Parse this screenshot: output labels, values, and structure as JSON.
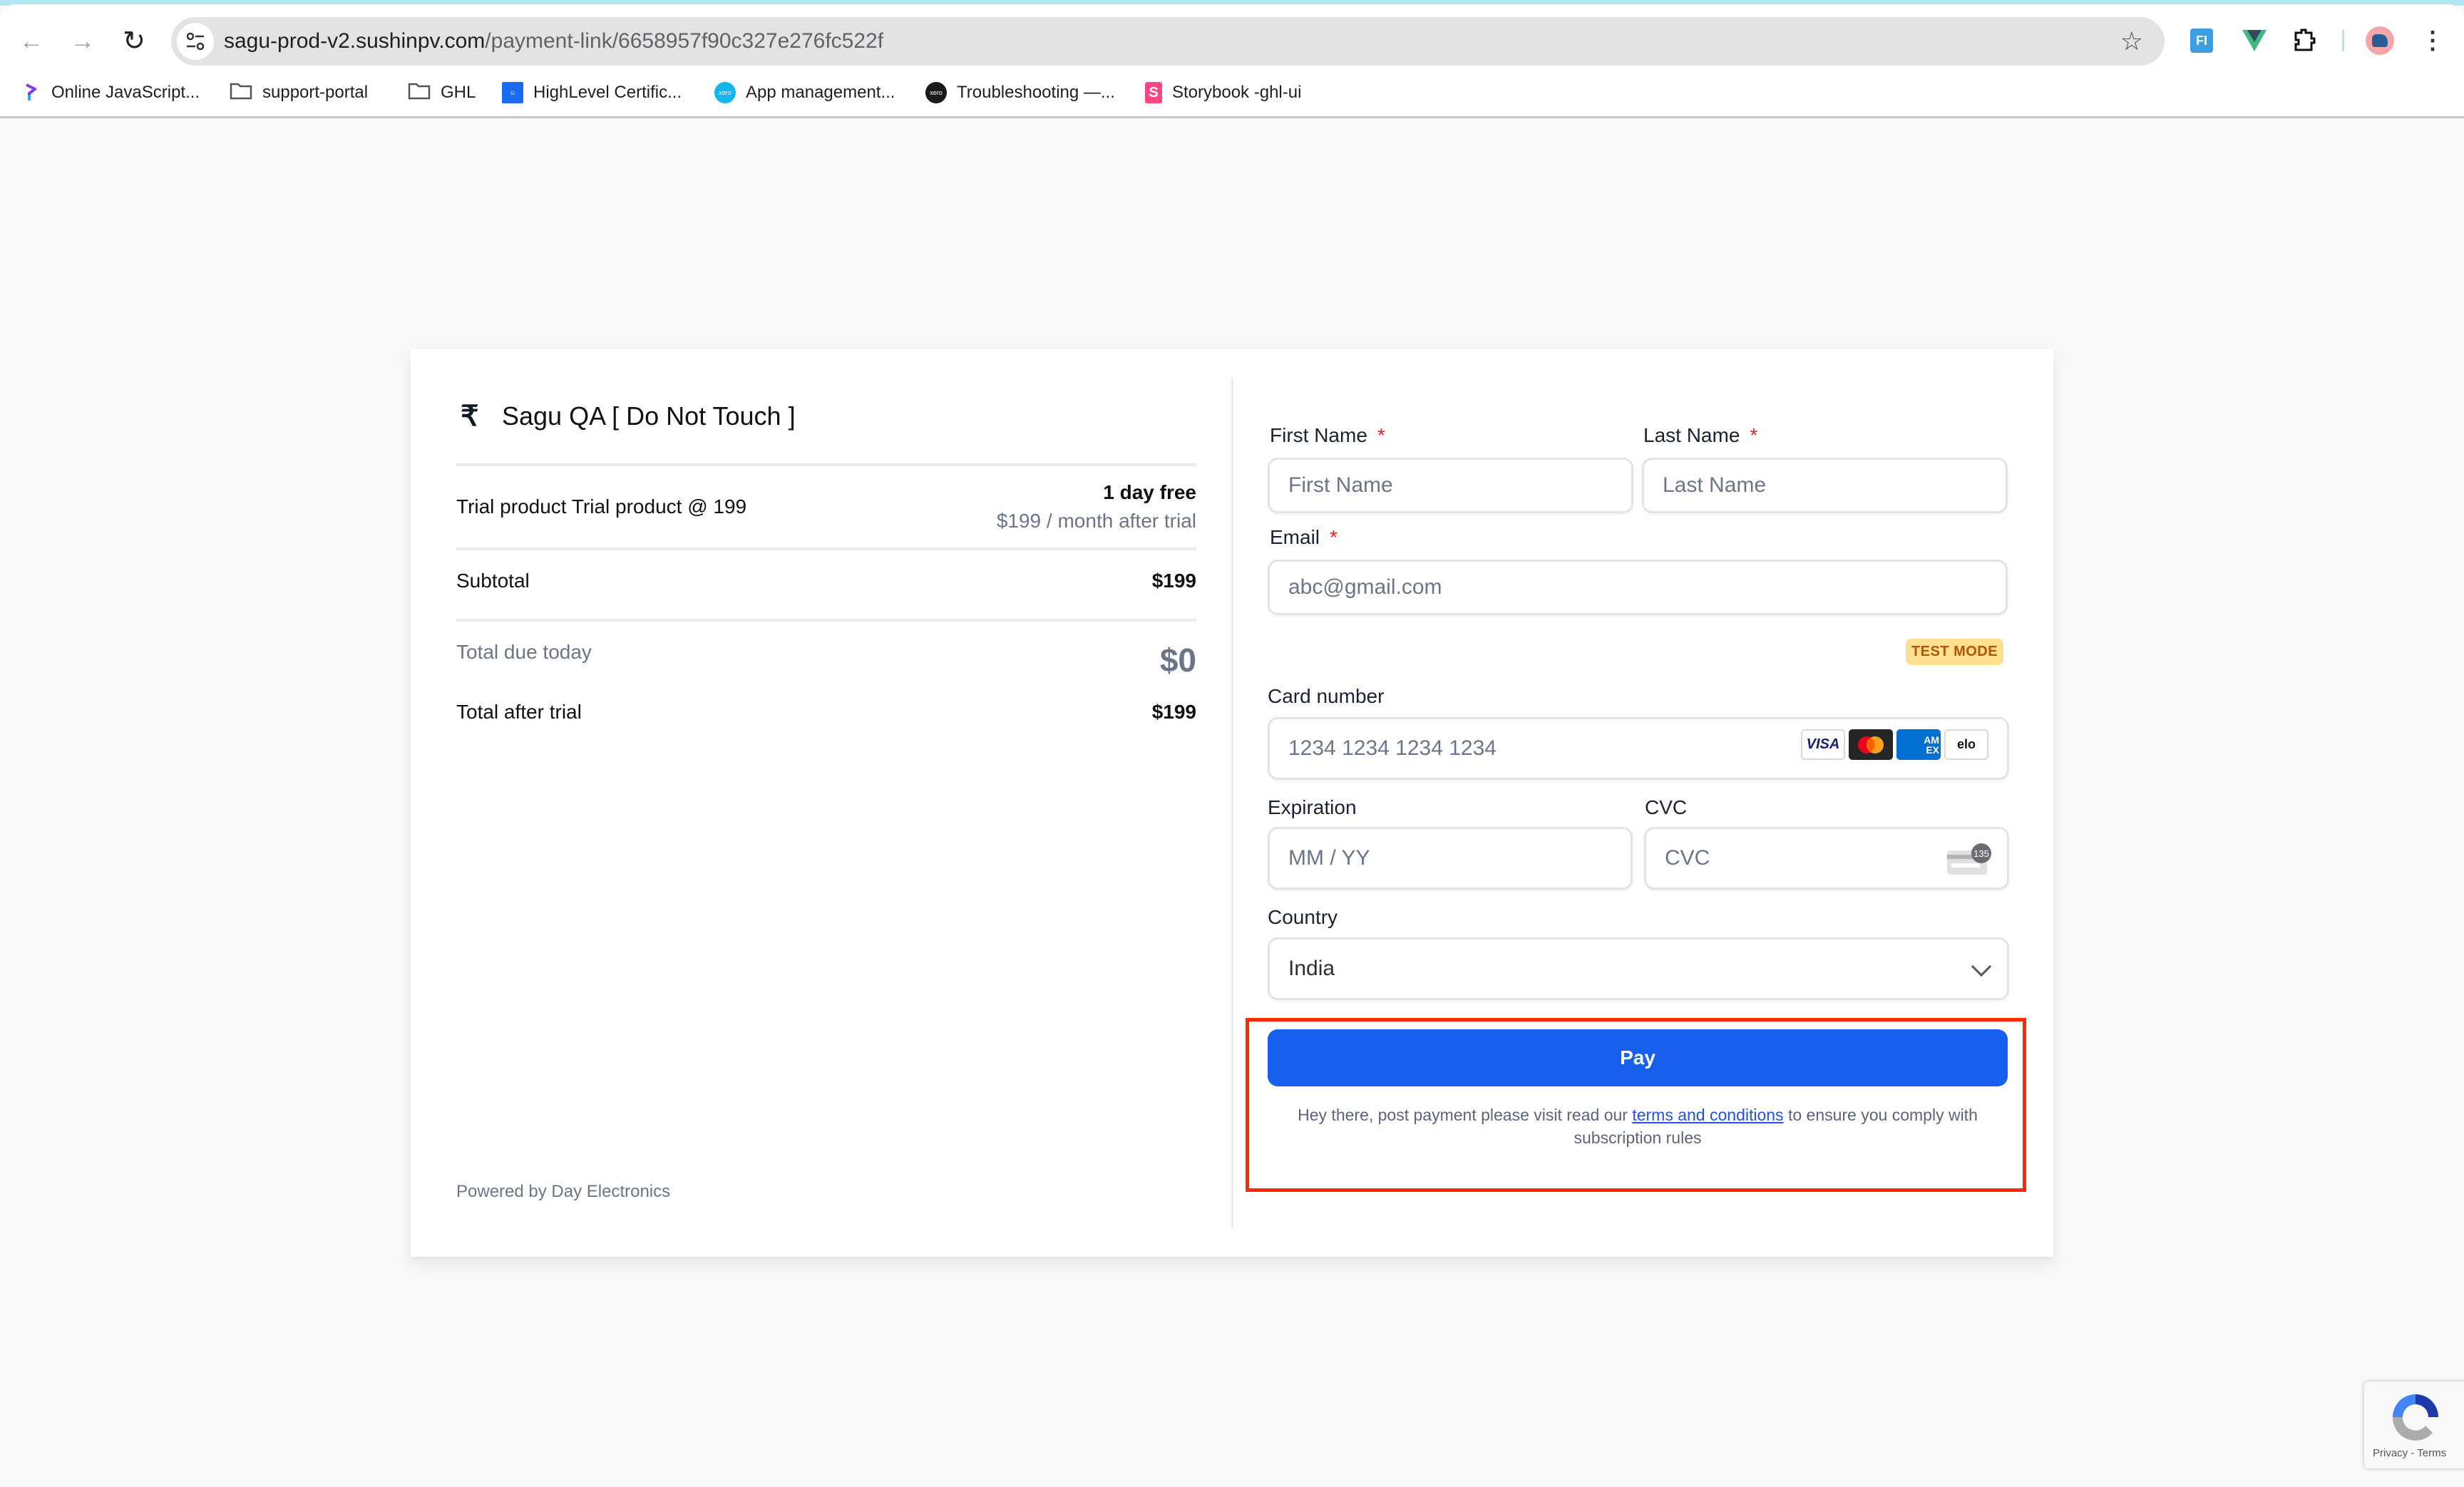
{
  "browser": {
    "url_host": "sagu-prod-v2.sushinpv.com",
    "url_path": "/payment-link/6658957f90c327e276fc522f",
    "bookmarks": [
      {
        "label": "Online JavaScript...",
        "icon": "playcode-icon"
      },
      {
        "label": "support-portal",
        "icon": "folder-icon"
      },
      {
        "label": "GHL",
        "icon": "folder-icon"
      },
      {
        "label": "HighLevel Certific...",
        "icon": "highlevel-icon"
      },
      {
        "label": "App management...",
        "icon": "xero-icon"
      },
      {
        "label": "Troubleshooting —...",
        "icon": "xero-dark-icon"
      },
      {
        "label": "Storybook -ghl-ui",
        "icon": "storybook-icon"
      }
    ],
    "extensions": [
      "fi-extension-icon",
      "vue-devtools-icon",
      "extensions-puzzle-icon",
      "profile-avatar",
      "menu-kebab-icon"
    ]
  },
  "summary": {
    "currency_symbol": "₹",
    "store_name": "Sagu QA [ Do Not Touch ]",
    "product_name": "Trial product Trial product @ 199",
    "trial_label": "1 day free",
    "trial_after": "$199 / month after trial",
    "subtotal_label": "Subtotal",
    "subtotal_value": "$199",
    "due_today_label": "Total due today",
    "due_today_value": "$0",
    "after_trial_label": "Total after trial",
    "after_trial_value": "$199",
    "powered_by": "Powered by Day Electronics"
  },
  "form": {
    "first_name_label": "First Name",
    "first_name_placeholder": "First Name",
    "last_name_label": "Last Name",
    "last_name_placeholder": "Last Name",
    "email_label": "Email",
    "email_placeholder": "abc@gmail.com",
    "required_mark": "*",
    "test_mode_badge": "TEST MODE",
    "card_number_label": "Card number",
    "card_number_placeholder": "1234 1234 1234 1234",
    "card_brands": [
      "VISA",
      "Mastercard",
      "AMEX",
      "elo"
    ],
    "expiration_label": "Expiration",
    "expiration_placeholder": "MM / YY",
    "cvc_label": "CVC",
    "cvc_placeholder": "CVC",
    "cvc_hint": "135",
    "country_label": "Country",
    "country_value": "India",
    "pay_label": "Pay",
    "terms_prefix": "Hey there, post payment please visit read our ",
    "terms_link": "terms and conditions",
    "terms_suffix": " to ensure you comply with subscription rules"
  },
  "recaptcha": {
    "links": "Privacy - Terms"
  },
  "colors": {
    "primary": "#175fef",
    "highlight": "#ff2a00",
    "badge_bg": "#fde08f",
    "badge_text": "#b4540a",
    "required": "#e0261b"
  }
}
